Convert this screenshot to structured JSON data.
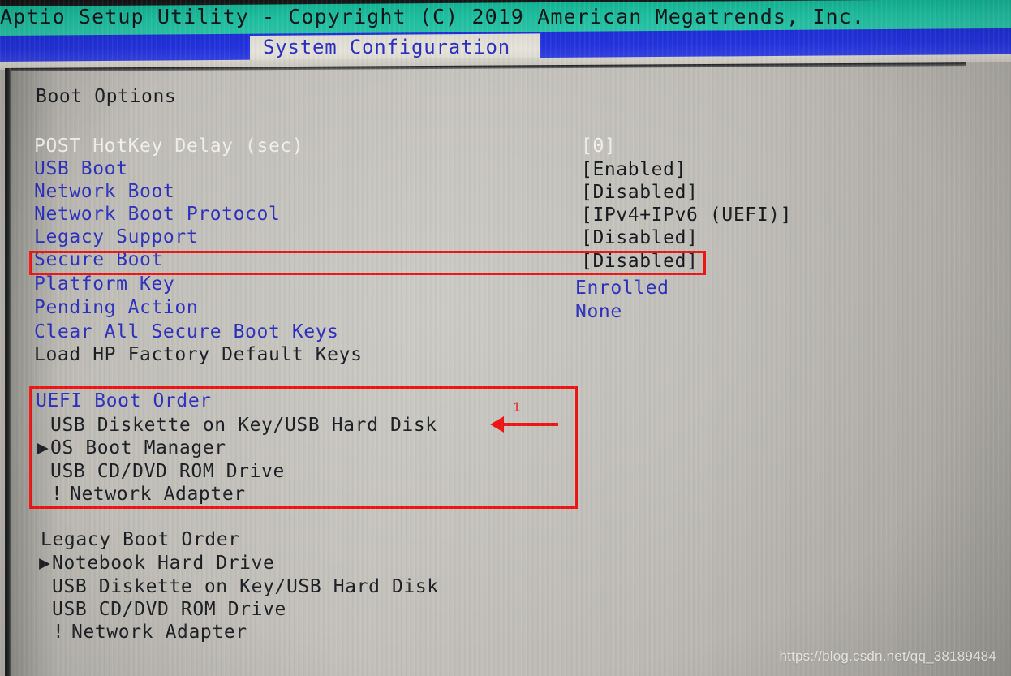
{
  "header": {
    "title": "Aptio Setup Utility - Copyright (C) 2019 American Megatrends, Inc.",
    "active_tab": "System Configuration",
    "titlebar_color": "#1ebfa0",
    "tabbar_color": "#2333dd",
    "tab_text_color": "#2b2fc0"
  },
  "content": {
    "section_title": "Boot Options",
    "settings": [
      {
        "label": "POST HotKey Delay (sec)",
        "value": "[0]",
        "label_style": "gray",
        "value_style": "gray"
      },
      {
        "label": "USB Boot",
        "value": "[Enabled]",
        "label_style": "blue",
        "value_style": "dark"
      },
      {
        "label": "Network Boot",
        "value": "[Disabled]",
        "label_style": "blue",
        "value_style": "dark"
      },
      {
        "label": "Network Boot Protocol",
        "value": "[IPv4+IPv6 (UEFI)]",
        "label_style": "blue",
        "value_style": "dark"
      },
      {
        "label": "Legacy Support",
        "value": "[Disabled]",
        "label_style": "blue",
        "value_style": "dark"
      },
      {
        "label": "Secure Boot",
        "value": "[Disabled]",
        "label_style": "blue",
        "value_style": "dark"
      },
      {
        "label": "Platform Key",
        "value": "Enrolled",
        "label_style": "blue",
        "value_style": "blue"
      },
      {
        "label": "Pending Action",
        "value": "None",
        "label_style": "blue",
        "value_style": "blue"
      },
      {
        "label": "Clear All Secure Boot Keys",
        "value": "",
        "label_style": "blue",
        "value_style": "dark"
      },
      {
        "label": "Load HP Factory Default Keys",
        "value": "",
        "label_style": "dark",
        "value_style": "dark"
      }
    ],
    "uefi_boot_order": {
      "title": "UEFI Boot Order",
      "items": [
        {
          "marker": "",
          "label": "USB Diskette on Key/USB Hard Disk"
        },
        {
          "marker": "▶",
          "label": "OS Boot Manager"
        },
        {
          "marker": "",
          "label": "USB CD/DVD ROM Drive"
        },
        {
          "marker": "!",
          "label": "Network Adapter"
        }
      ]
    },
    "legacy_boot_order": {
      "title": "Legacy Boot Order",
      "items": [
        {
          "marker": "▶",
          "label": "Notebook Hard Drive"
        },
        {
          "marker": "",
          "label": "USB Diskette on Key/USB Hard Disk"
        },
        {
          "marker": "",
          "label": "USB CD/DVD ROM Drive"
        },
        {
          "marker": "!",
          "label": "Network Adapter"
        }
      ]
    }
  },
  "annotations": {
    "color": "#f01414",
    "secure_boot_highlight": "Secure Boot row highlighted",
    "uefi_order_highlight": "UEFI Boot Order block highlighted",
    "arrow_label": "1"
  },
  "watermark": {
    "text": "https://blog.csdn.net/qq_38189484"
  }
}
